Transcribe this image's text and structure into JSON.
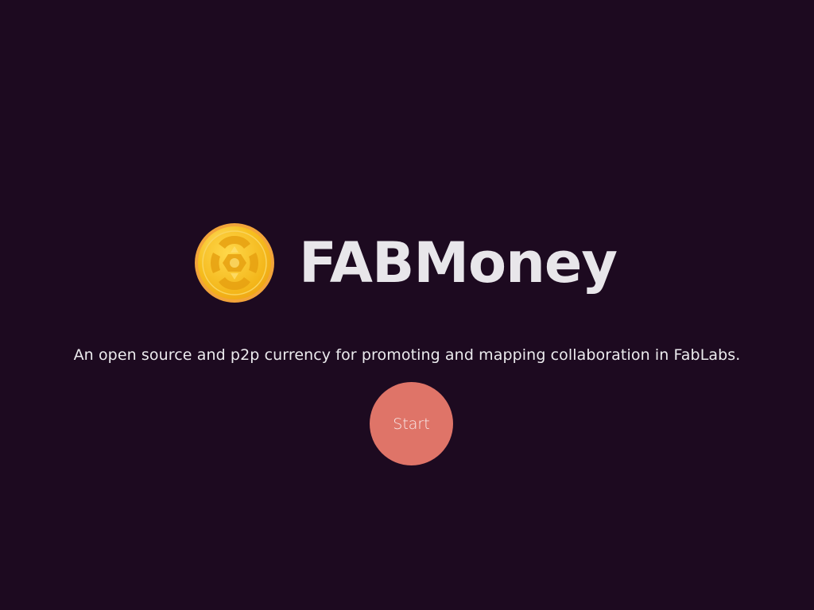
{
  "brand": {
    "logo_icon": "coin-logo-icon",
    "title": "FABMoney"
  },
  "tagline": "An open source and p2p currency for promoting and mapping collaboration in FabLabs.",
  "cta": {
    "start_label": "Start"
  },
  "colors": {
    "background": "#1d0a20",
    "title": "#e8e6ea",
    "button": "#df7468",
    "coin_gold": "#f7c01f",
    "coin_rim": "#f2a43a"
  }
}
